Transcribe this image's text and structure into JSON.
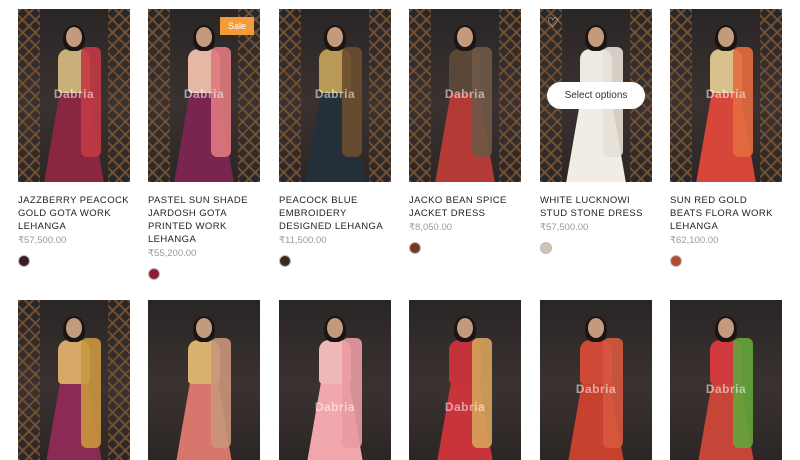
{
  "products": [
    {
      "title": "JAZZBERRY PEACOCK GOLD GOTA WORK LEHANGA",
      "price": "₹57,500.00",
      "swatch_color": "#3b1a22",
      "colors": {
        "bodice": "#c9b07a",
        "skirt": "#8a2740",
        "drape": "#c23a45"
      },
      "watermark": "Dabria"
    },
    {
      "title": "PASTEL SUN SHADE JARDOSH GOTA PRINTED WORK LEHANGA",
      "price": "₹55,200.00",
      "swatch_color": "#8d1c35",
      "colors": {
        "bodice": "#e5b8a6",
        "skirt": "#7a2550",
        "drape": "#e07a7f"
      },
      "badge": "Sale",
      "watermark": "Dabria"
    },
    {
      "title": "PEACOCK BLUE EMBROIDERY DESIGNED LEHANGA",
      "price": "₹11,500.00",
      "swatch_color": "#3a2818",
      "colors": {
        "bodice": "#b89a56",
        "skirt": "#23303a",
        "drape": "#6b4e2e"
      },
      "watermark": "Dabria"
    },
    {
      "title": "JACKO BEAN SPICE JACKET DRESS",
      "price": "₹8,050.00",
      "swatch_color": "#7a3525",
      "colors": {
        "bodice": "#5b4738",
        "skirt": "#b43a36",
        "drape": "#6f5846"
      },
      "watermark": "Dabria"
    },
    {
      "title": "WHITE LUCKNOWI STUD STONE DRESS",
      "price": "₹57,500.00",
      "swatch_color": "#cfc6b8",
      "colors": {
        "bodice": "#eeeae2",
        "skirt": "#f1ede6",
        "drape": "#e6e0d6"
      },
      "quick_view": "Select options",
      "wishlist": "heart-icon"
    },
    {
      "title": "SUN RED GOLD BEATS FLORA WORK LEHANGA",
      "price": "₹62,100.00",
      "swatch_color": "#b24a34",
      "colors": {
        "bodice": "#d8c08b",
        "skirt": "#d6473a",
        "drape": "#e56b3f"
      },
      "watermark": "Dabria"
    }
  ],
  "products_row2": [
    {
      "colors": {
        "bodice": "#d7a867",
        "skirt": "#8b2a55",
        "drape": "#c9973f"
      }
    },
    {
      "colors": {
        "bodice": "#d8b36e",
        "skirt": "#d7766d",
        "drape": "#c9967a"
      }
    },
    {
      "colors": {
        "bodice": "#f0b7b9",
        "skirt": "#f2a7ad",
        "drape": "#e99ba2"
      },
      "watermark": "Dabria"
    },
    {
      "colors": {
        "bodice": "#c3323b",
        "skirt": "#c9333a",
        "drape": "#d7a35d"
      },
      "watermark": "Dabria"
    },
    {
      "colors": {
        "bodice": "#cf4a36",
        "skirt": "#c6422f",
        "drape": "#d6593e"
      },
      "watermark": "Dabria"
    },
    {
      "colors": {
        "bodice": "#d03a3e",
        "skirt": "#c64538",
        "drape": "#63a53c"
      },
      "watermark": "Dabria"
    }
  ]
}
